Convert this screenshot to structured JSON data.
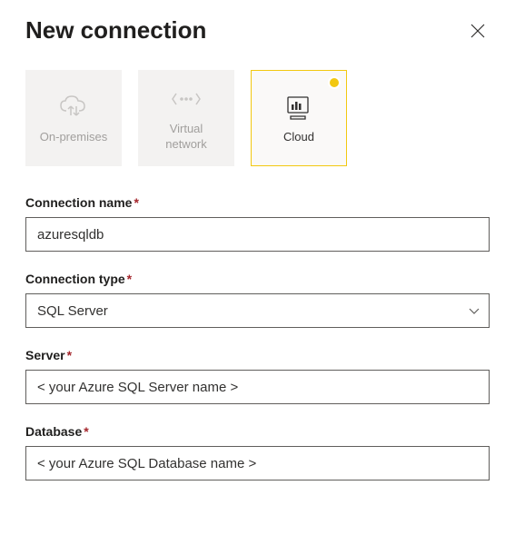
{
  "header": {
    "title": "New connection"
  },
  "tiles": {
    "on_premises": "On-premises",
    "virtual_network": "Virtual\nnetwork",
    "cloud": "Cloud"
  },
  "form": {
    "connection_name": {
      "label": "Connection name",
      "value": "azuresqldb"
    },
    "connection_type": {
      "label": "Connection type",
      "value": "SQL Server"
    },
    "server": {
      "label": "Server",
      "value": "< your Azure SQL Server name >"
    },
    "database": {
      "label": "Database",
      "value": "< your Azure SQL Database name >"
    }
  }
}
